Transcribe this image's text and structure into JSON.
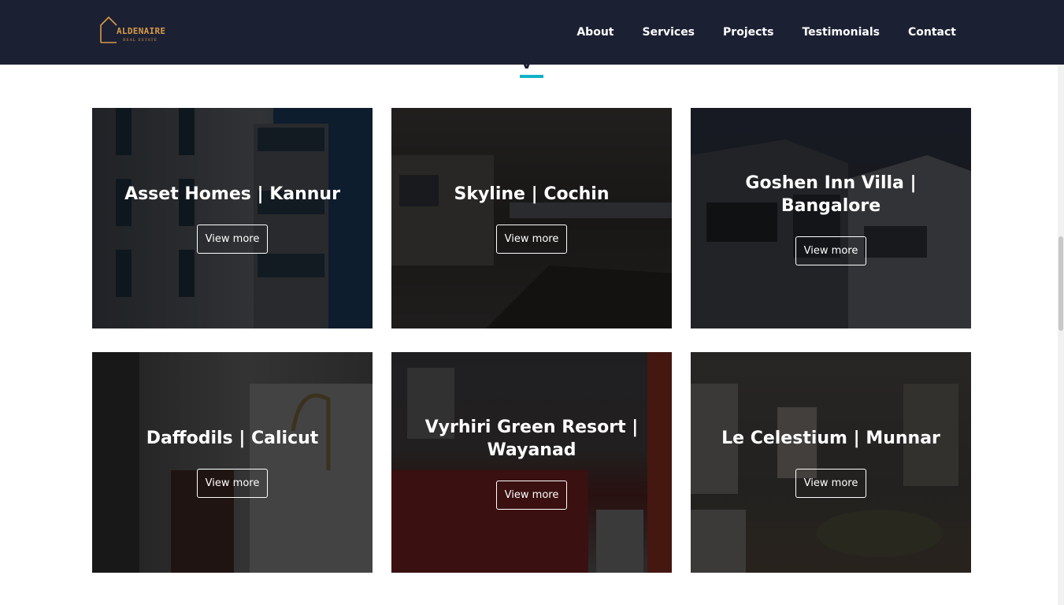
{
  "brand": {
    "logo_text": "ALDENAIRE",
    "logo_subtext": "REAL ESTATE",
    "accent_color": "#d79b4a"
  },
  "nav": {
    "items": [
      "About",
      "Services",
      "Projects",
      "Testimonials",
      "Contact"
    ]
  },
  "section": {
    "accent_color": "#14b1c8"
  },
  "projects": [
    {
      "title": "Asset Homes | Kannur",
      "button": "View more"
    },
    {
      "title": "Skyline | Cochin",
      "button": "View more"
    },
    {
      "title": "Goshen Inn Villa | Bangalore",
      "button": "View more"
    },
    {
      "title": "Daffodils | Calicut",
      "button": "View more"
    },
    {
      "title": "Vyrhiri Green Resort | Wayanad",
      "button": "View more"
    },
    {
      "title": "Le Celestium | Munnar",
      "button": "View more"
    }
  ]
}
